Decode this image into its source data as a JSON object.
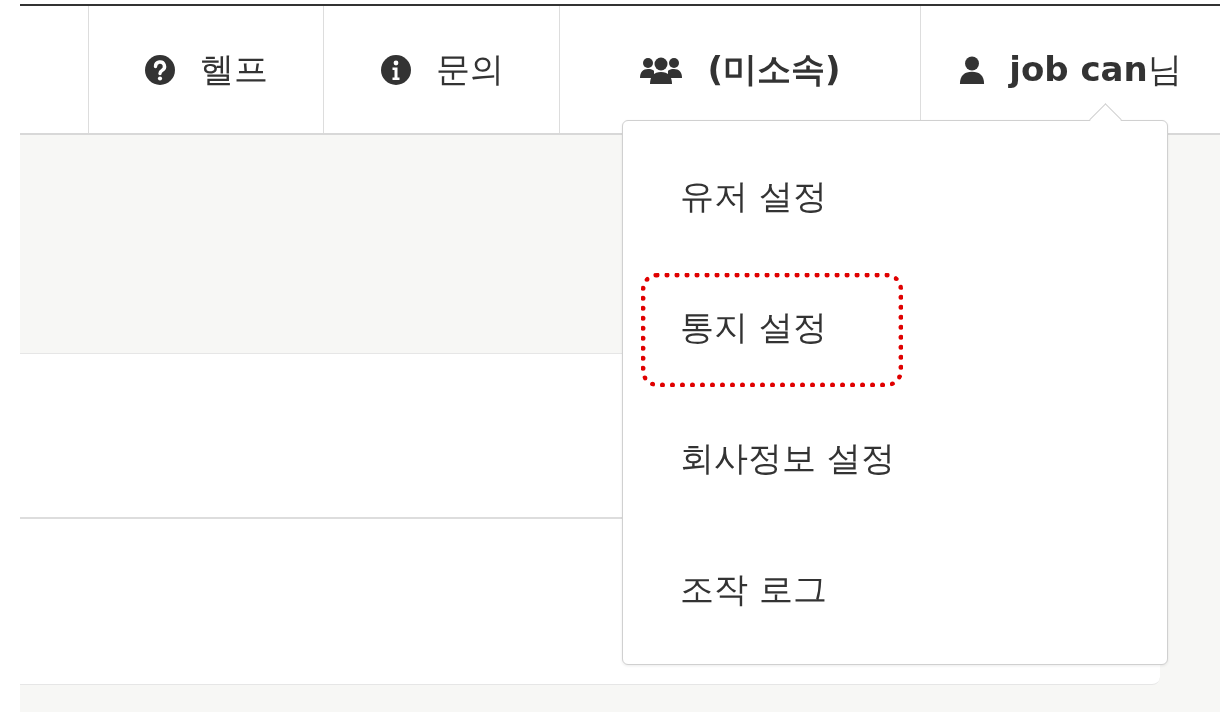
{
  "nav": [
    {
      "kind": "help",
      "label": "헬프"
    },
    {
      "kind": "info",
      "label": "문의"
    },
    {
      "kind": "group",
      "label": "(미소속)"
    },
    {
      "kind": "user",
      "label": "**job can**님"
    }
  ],
  "user_menu": {
    "expanded": true,
    "items": [
      {
        "label": "유저 설정",
        "highlighted": false
      },
      {
        "label": "통지 설정",
        "highlighted": true
      },
      {
        "label": "회사정보 설정",
        "highlighted": false
      },
      {
        "label": "조작 로그",
        "highlighted": false
      }
    ]
  }
}
